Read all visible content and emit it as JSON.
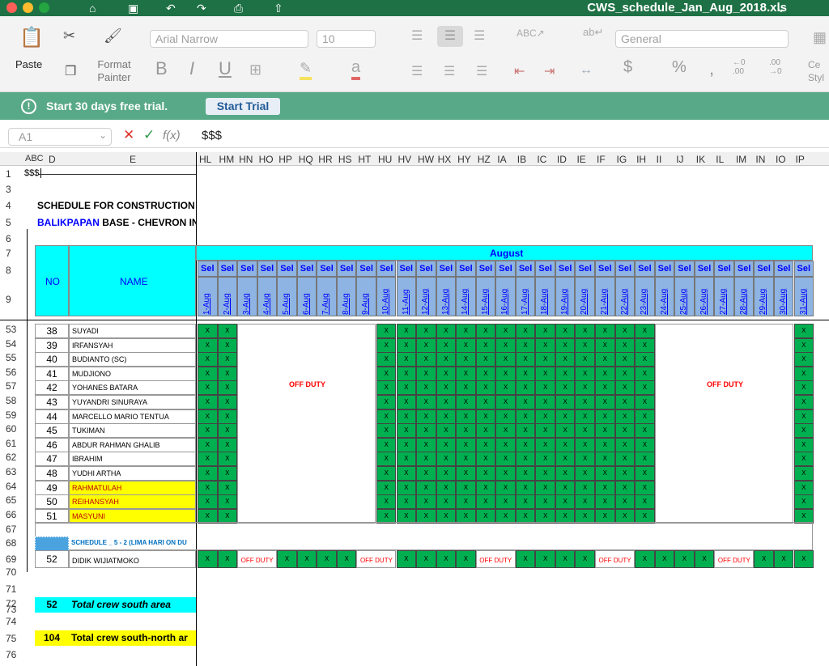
{
  "window": {
    "title": "CWS_schedule_Jan_Aug_2018.xls"
  },
  "ribbon": {
    "paste": "Paste",
    "format_painter": "Format Painter",
    "font_name": "Arial Narrow",
    "font_size": "10",
    "number_format": "General",
    "cell_styles": "Ce Styl",
    "bold": "B",
    "italic": "I",
    "underline": "U",
    "percent": "%",
    "dollar": "$",
    "comma": ","
  },
  "trial": {
    "message": "Start 30 days free trial.",
    "button": "Start Trial"
  },
  "formula": {
    "cell_ref": "A1",
    "fx": "f(x)",
    "value": "$$$"
  },
  "columns": [
    "A",
    "B",
    "C",
    "D",
    "E",
    "HL",
    "HM",
    "HN",
    "HO",
    "HP",
    "HQ",
    "HR",
    "HS",
    "HT",
    "HU",
    "HV",
    "HW",
    "HX",
    "HY",
    "HZ",
    "IA",
    "IB",
    "IC",
    "ID",
    "IE",
    "IF",
    "IG",
    "IH",
    "II",
    "IJ",
    "IK",
    "IL",
    "IM",
    "IN",
    "IO",
    "IP"
  ],
  "sheet": {
    "a1": "$$$",
    "title1": "SCHEDULE FOR CONSTRUCTION W",
    "title2_blue": "BALIKPAPAN",
    "title2_rest": " BASE - CHEVRON IN",
    "month": "August",
    "day_label": "Sel",
    "no_header": "NO",
    "name_header": "NAME",
    "dates": [
      "1-Aug",
      "2-Aug",
      "3-Aug",
      "4-Aug",
      "5-Aug",
      "6-Aug",
      "7-Aug",
      "8-Aug",
      "9-Aug",
      "10-Aug",
      "11-Aug",
      "12-Aug",
      "13-Aug",
      "14-Aug",
      "15-Aug",
      "16-Aug",
      "17-Aug",
      "18-Aug",
      "19-Aug",
      "20-Aug",
      "21-Aug",
      "22-Aug",
      "23-Aug",
      "24-Aug",
      "25-Aug",
      "26-Aug",
      "27-Aug",
      "28-Aug",
      "29-Aug",
      "30-Aug",
      "31-Aug"
    ],
    "off_duty": "OFF DUTY",
    "mark": "X",
    "crew": [
      {
        "no": "38",
        "name": "SUYADI"
      },
      {
        "no": "39",
        "name": "IRFANSYAH"
      },
      {
        "no": "40",
        "name": "BUDIANTO (SC)"
      },
      {
        "no": "41",
        "name": "MUDJIONO"
      },
      {
        "no": "42",
        "name": "YOHANES BATARA"
      },
      {
        "no": "43",
        "name": "YUYANDRI SINURAYA"
      },
      {
        "no": "44",
        "name": "MARCELLO MARIO TENTUA"
      },
      {
        "no": "45",
        "name": "TUKIMAN"
      },
      {
        "no": "46",
        "name": "ABDUR RAHMAN GHALIB"
      },
      {
        "no": "47",
        "name": "IBRAHIM"
      },
      {
        "no": "48",
        "name": "YUDHI ARTHA"
      },
      {
        "no": "49",
        "name": "RAHMATULAH",
        "highlight": "#ffff00"
      },
      {
        "no": "50",
        "name": "REIHANSYAH",
        "highlight": "#ffff00"
      },
      {
        "no": "51",
        "name": "MASYUNI",
        "highlight": "#ffff00"
      }
    ],
    "row_numbers": [
      "53",
      "54",
      "55",
      "56",
      "57",
      "58",
      "59",
      "60",
      "61",
      "62",
      "63",
      "64",
      "65",
      "66"
    ],
    "schedule_label": "SCHEDULE _ 5 - 2 (LIMA HARI ON DU",
    "row69": {
      "no": "52",
      "name": "DIDIK WIJIATMOKO"
    },
    "total_south": {
      "value": "52",
      "label": "Total crew south area"
    },
    "total_all": {
      "value": "104",
      "label": "Total crew south-north ar"
    }
  },
  "colors": {
    "green": "#00b050",
    "cyan": "#00ffff",
    "yellow": "#ffff00",
    "title_green": "#1e7145",
    "trial": "#58a987"
  }
}
